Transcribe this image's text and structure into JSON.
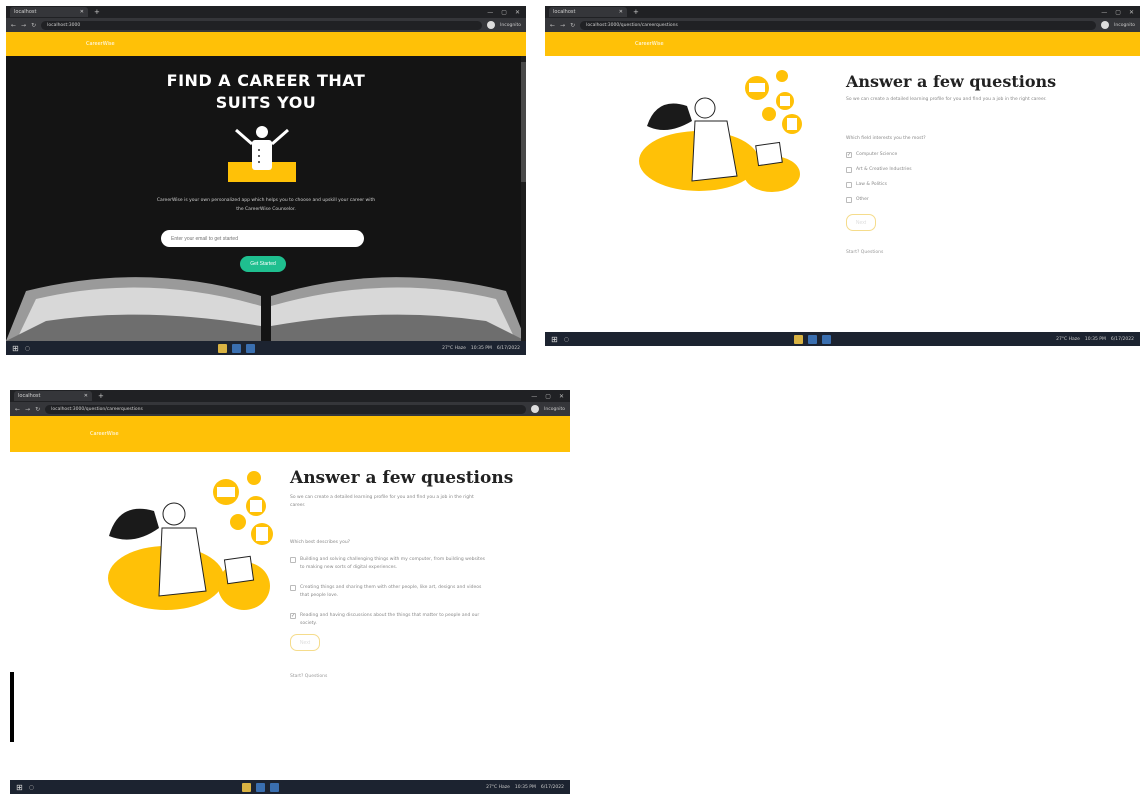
{
  "colors": {
    "brand_yellow": "#ffc107",
    "hero_bg": "#141414",
    "accent_green": "#1fbf8f",
    "chrome_dark": "#202124"
  },
  "browser": {
    "tab_title": "localhost",
    "url_landing": "localhost:3000",
    "url_quiz": "localhost:3000/question/careerquestions",
    "profile_label": "Incognito"
  },
  "site": {
    "brand": "CareerWise"
  },
  "landing": {
    "title_line1": "FIND A CAREER THAT",
    "title_line2": "SUITS YOU",
    "description": "CareerWise is your own personalized app which helps you to choose and upskill your career with the CareerWise Counselor.",
    "input_placeholder": "Enter your email to get started",
    "cta_label": "Get Started"
  },
  "quiz": {
    "title": "Answer a few questions",
    "subtitle": "So we can create a detailed learning profile for you and find you a job in the right career.",
    "screen1": {
      "question": "Which field interests you the most?",
      "options": [
        "Computer Science",
        "Art & Creative Industries",
        "Law & Politics",
        "Other"
      ],
      "next_label": "Next",
      "start_link": "Start? Questions"
    },
    "screen2": {
      "question": "Which best describes you?",
      "options": [
        "Building and solving challenging things with my computer, from building websites to making new sorts of digital experiences.",
        "Creating things and sharing them with other people, like art, designs and videos that people love.",
        "Reading and having discussions about the things that matter to people and our society."
      ],
      "next_label": "Next",
      "start_link": "Start? Questions"
    }
  },
  "taskbar": {
    "weather": "27°C Haze",
    "time": "10:35 PM",
    "date": "6/17/2022"
  }
}
